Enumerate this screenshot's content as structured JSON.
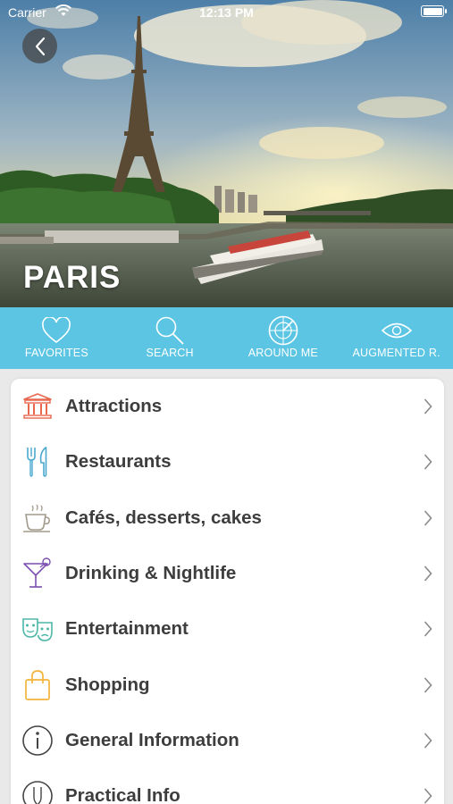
{
  "status_bar": {
    "carrier": "Carrier",
    "time": "12:13 PM"
  },
  "hero": {
    "city": "PARIS"
  },
  "tabs": [
    {
      "label": "FAVORITES",
      "icon": "heart-icon"
    },
    {
      "label": "SEARCH",
      "icon": "search-icon"
    },
    {
      "label": "AROUND ME",
      "icon": "radar-icon"
    },
    {
      "label": "AUGMENTED R.",
      "icon": "eye-icon"
    }
  ],
  "categories": [
    {
      "label": "Attractions",
      "icon": "monument-icon",
      "color": "#e8674e"
    },
    {
      "label": "Restaurants",
      "icon": "fork-knife-icon",
      "color": "#4aa8cf"
    },
    {
      "label": "Cafés, desserts, cakes",
      "icon": "coffee-cup-icon",
      "color": "#a39a8c"
    },
    {
      "label": "Drinking & Nightlife",
      "icon": "cocktail-icon",
      "color": "#7a4fb0"
    },
    {
      "label": "Entertainment",
      "icon": "theater-masks-icon",
      "color": "#4db7a8"
    },
    {
      "label": "Shopping",
      "icon": "shopping-bag-icon",
      "color": "#f3b43b"
    },
    {
      "label": "General Information",
      "icon": "info-icon",
      "color": "#444444"
    },
    {
      "label": "Practical Info",
      "icon": "practical-icon",
      "color": "#444444"
    }
  ],
  "colors": {
    "tabbar": "#5bc5e3",
    "text": "#3d3d3d",
    "chevron": "#8a8a8a"
  }
}
